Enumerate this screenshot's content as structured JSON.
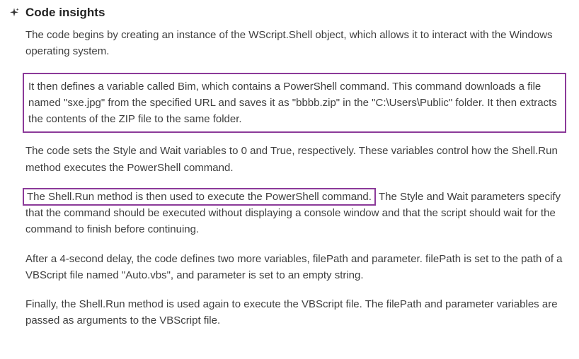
{
  "header": {
    "icon": "sparkle-icon",
    "title": "Code insights"
  },
  "paragraphs": {
    "p1": "The code begins by creating an instance of the WScript.Shell object, which allows it to interact with the Windows operating system.",
    "p2": "It then defines a variable called Bim, which contains a PowerShell command. This command downloads a file named \"sxe.jpg\" from the specified URL and saves it as \"bbbb.zip\" in the \"C:\\Users\\Public\" folder. It then extracts the contents of the ZIP file to the same folder.",
    "p3": "The code sets the Style and Wait variables to 0 and True, respectively. These variables control how the Shell.Run method executes the PowerShell command.",
    "p4_highlight": "The Shell.Run method is then used to execute the PowerShell command.",
    "p4_rest": "The Style and Wait parameters specify that the command should be executed without displaying a console window and that the script should wait for the command to finish before continuing.",
    "p5": "After a 4-second delay, the code defines two more variables, filePath and parameter. filePath is set to the path of a VBScript file named \"Auto.vbs\", and parameter is set to an empty string.",
    "p6": "Finally, the Shell.Run method is used again to execute the VBScript file. The filePath and parameter variables are passed as arguments to the VBScript file."
  }
}
